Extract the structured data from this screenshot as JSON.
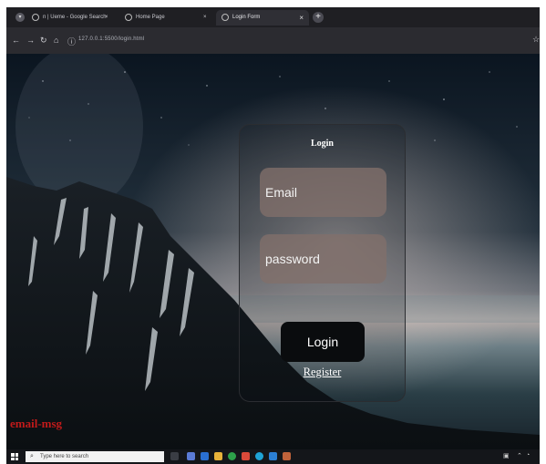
{
  "browser": {
    "tabs": [
      {
        "label": "n | Ueme - Google Search",
        "active": false
      },
      {
        "label": "Home Page",
        "active": false
      },
      {
        "label": "Login Form",
        "active": true
      }
    ],
    "url": "127.0.0.1:5500/login.html"
  },
  "page": {
    "title": "Login",
    "email_placeholder": "Email",
    "password_placeholder": "password",
    "login_label": "Login",
    "register_label": "Register",
    "email_msg": "email-msg"
  },
  "taskbar": {
    "search_placeholder": "Type here to search"
  },
  "colors": {
    "message": "#c11a1a",
    "field_bg": "#82706a",
    "button_bg": "#0a0c0e"
  }
}
